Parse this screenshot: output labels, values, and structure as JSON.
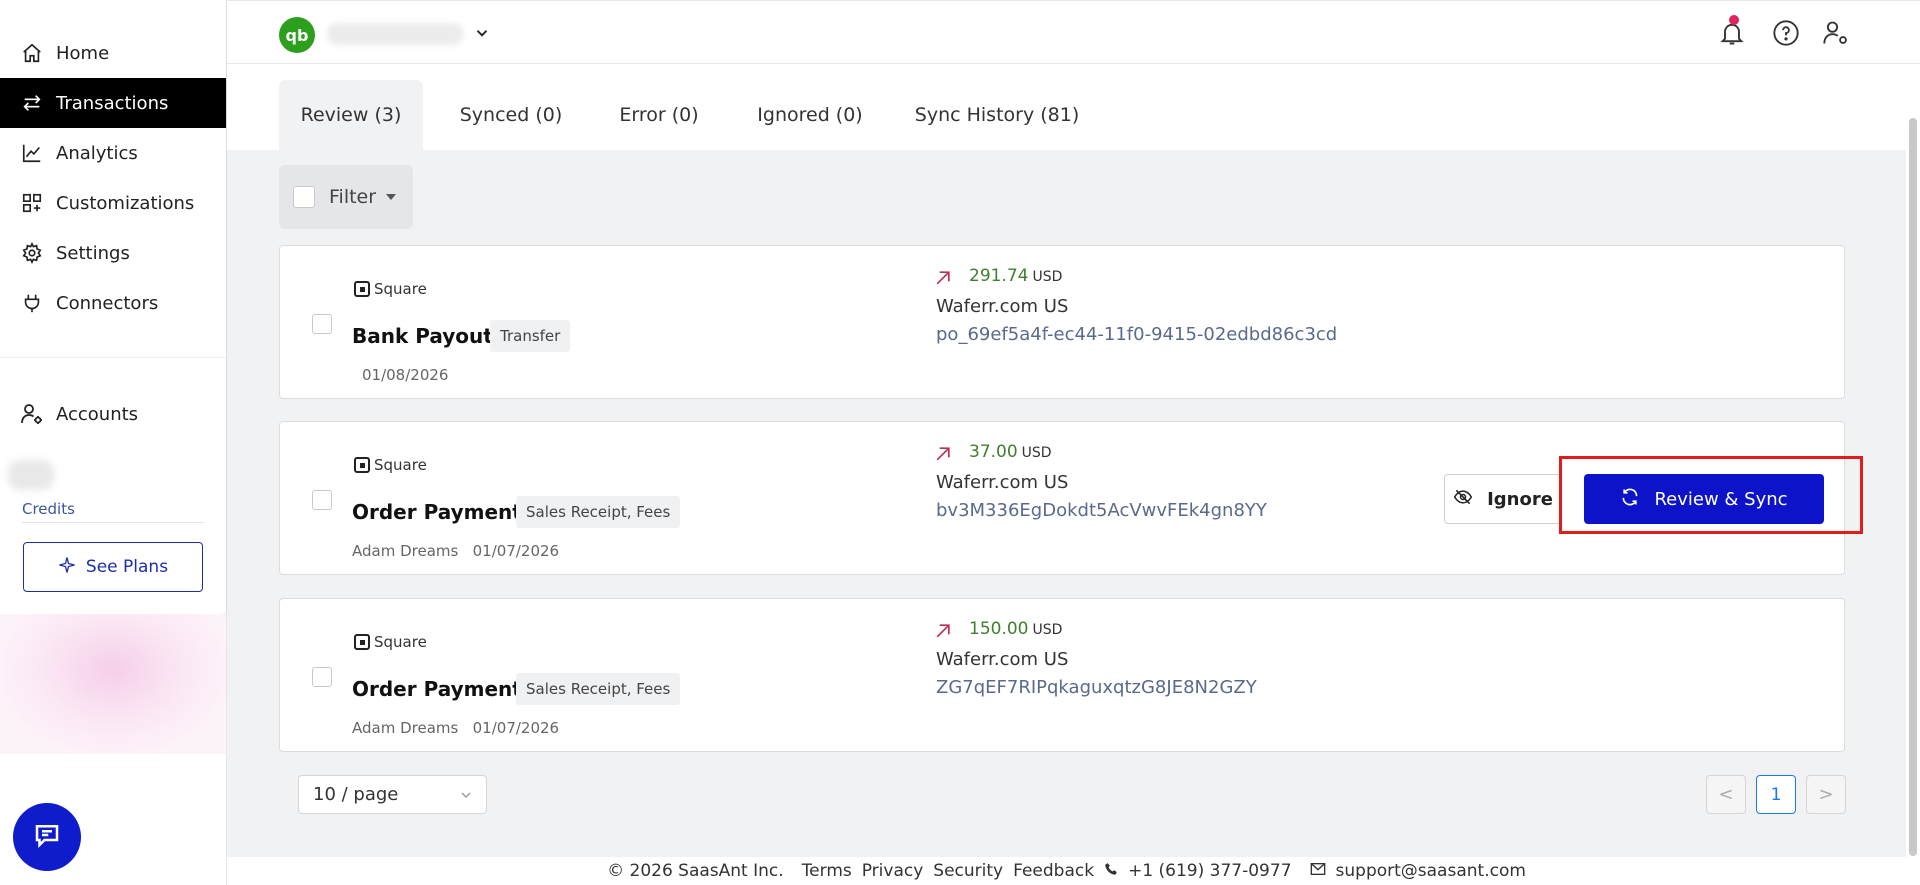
{
  "sidebar": {
    "items": [
      {
        "label": "Home",
        "icon": "home-icon"
      },
      {
        "label": "Transactions",
        "icon": "arrows-icon"
      },
      {
        "label": "Analytics",
        "icon": "chart-line-icon"
      },
      {
        "label": "Customizations",
        "icon": "grid-plus-icon"
      },
      {
        "label": "Settings",
        "icon": "gear-icon"
      },
      {
        "label": "Connectors",
        "icon": "plug-icon"
      }
    ],
    "accounts_label": "Accounts",
    "credits_label": "Credits",
    "see_plans_label": "See Plans"
  },
  "header": {
    "logo_text": "qb"
  },
  "tabs": [
    {
      "label": "Review (3)"
    },
    {
      "label": "Synced (0)"
    },
    {
      "label": "Error (0)"
    },
    {
      "label": "Ignored (0)"
    },
    {
      "label": "Sync History (81)"
    }
  ],
  "filter": {
    "label": "Filter"
  },
  "transactions": [
    {
      "source": "Square",
      "title": "Bank Payout",
      "tag": "Transfer",
      "customer": "",
      "date": "01/08/2026",
      "amount": "291.74",
      "currency": "USD",
      "merchant": "Waferr.com US",
      "ref": "po_69ef5a4f-ec44-11f0-9415-02edbd86c3cd"
    },
    {
      "source": "Square",
      "title": "Order Payment",
      "tag": "Sales Receipt, Fees",
      "customer": "Adam Dreams",
      "date": "01/07/2026",
      "amount": "37.00",
      "currency": "USD",
      "merchant": "Waferr.com US",
      "ref": "bv3M336EgDokdt5AcVwvFEk4gn8YY"
    },
    {
      "source": "Square",
      "title": "Order Payment",
      "tag": "Sales Receipt, Fees",
      "customer": "Adam Dreams",
      "date": "01/07/2026",
      "amount": "150.00",
      "currency": "USD",
      "merchant": "Waferr.com US",
      "ref": "ZG7qEF7RIPqkaguxqtzG8JE8N2GZY"
    }
  ],
  "actions": {
    "ignore_label": "Ignore",
    "sync_label": "Review & Sync"
  },
  "pagination": {
    "page_size": "10 / page",
    "current_page": "1",
    "prev": "<",
    "next": ">"
  },
  "footer": {
    "copyright": "© 2026 SaasAnt Inc.",
    "links": [
      "Terms",
      "Privacy",
      "Security",
      "Feedback"
    ],
    "phone": "+1 (619) 377-0977",
    "email": "support@saasant.com"
  },
  "colors": {
    "accent": "#0d13c8",
    "highlight": "#e21b1b",
    "amount_green": "#3f7f2e",
    "qb_green": "#2ca01c"
  }
}
